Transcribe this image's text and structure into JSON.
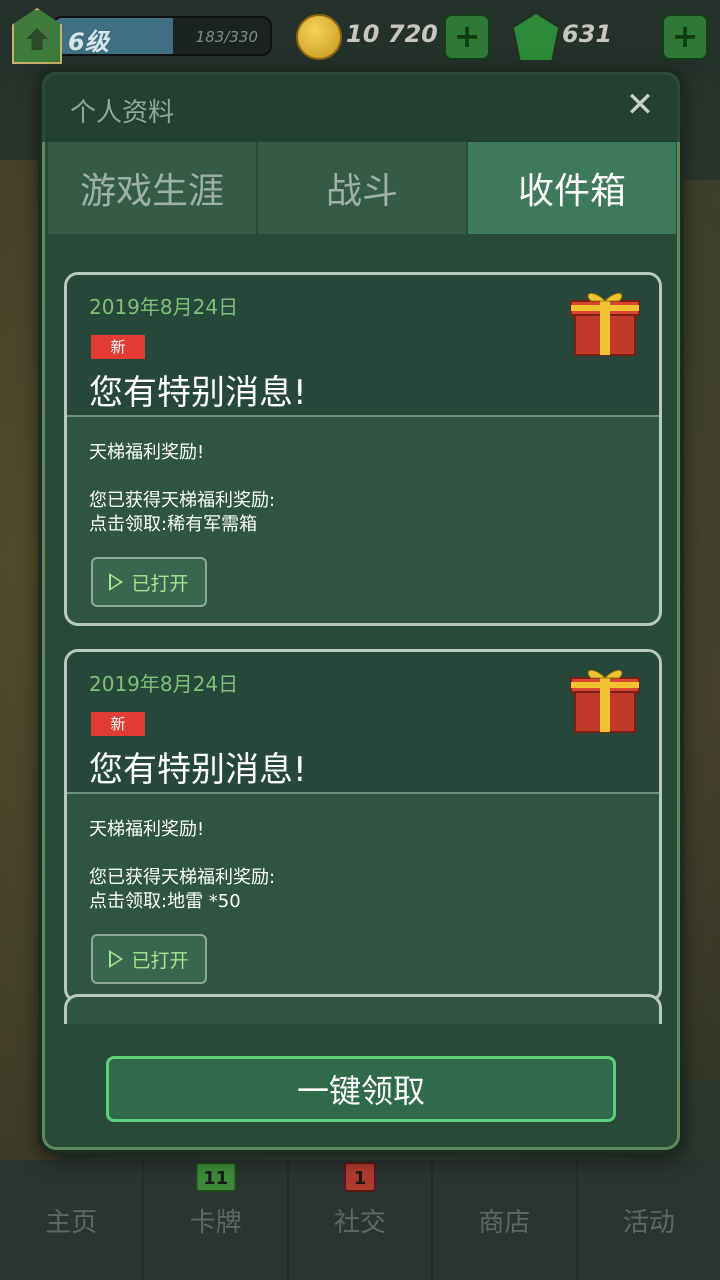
{
  "hud": {
    "level_label": "6级",
    "xp_text": "183/330",
    "xp_progress": 0.55,
    "coins": "10 720",
    "gems": "631",
    "plus_symbol": "+"
  },
  "modal": {
    "title": "个人资料",
    "close_symbol": "✕",
    "tabs": [
      {
        "label": "游戏生涯",
        "active": false
      },
      {
        "label": "战斗",
        "active": false
      },
      {
        "label": "收件箱",
        "active": true
      }
    ],
    "messages": [
      {
        "date": "2019年8月24日",
        "badge": "新",
        "title": "您有特别消息!",
        "line1": "天梯福利奖励!",
        "line2": "您已获得天梯福利奖励:",
        "line3": "点击领取:稀有军需箱",
        "button": "已打开",
        "icon": "gift-box-icon"
      },
      {
        "date": "2019年8月24日",
        "badge": "新",
        "title": "您有特别消息!",
        "line1": "天梯福利奖励!",
        "line2": "您已获得天梯福利奖励:",
        "line3": "点击领取:地雷 *50",
        "button": "已打开",
        "icon": "gift-box-icon"
      }
    ],
    "claim_all": "一键领取"
  },
  "bottom_nav": {
    "items": [
      {
        "label": "主页"
      },
      {
        "label": "卡牌",
        "badge": "11"
      },
      {
        "label": "社交",
        "badge": "1"
      },
      {
        "label": "商店"
      },
      {
        "label": "活动"
      }
    ]
  },
  "colors": {
    "accent_green": "#5ccf7a",
    "date_green": "#7fc07a",
    "new_badge_red": "#e23c32",
    "active_tab": "#3d7a5c"
  }
}
